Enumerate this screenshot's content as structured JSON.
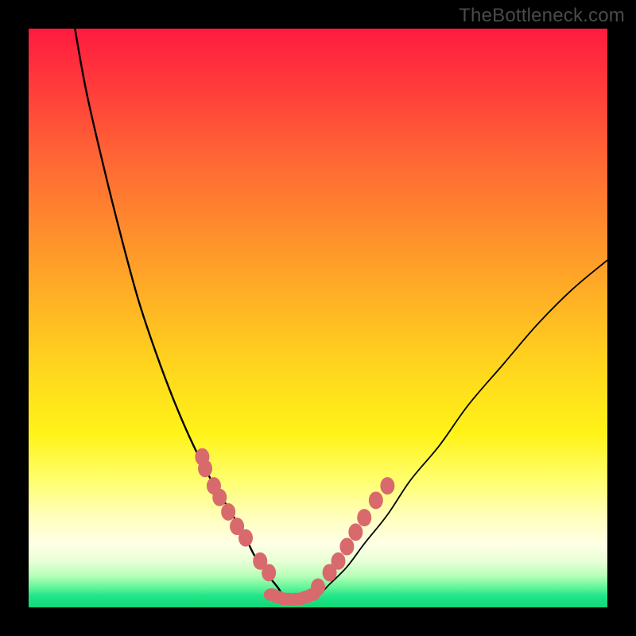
{
  "watermark": "TheBottleneck.com",
  "chart_data": {
    "type": "line",
    "title": "",
    "xlabel": "",
    "ylabel": "",
    "xlim": [
      0,
      100
    ],
    "ylim": [
      0,
      100
    ],
    "grid": false,
    "series": [
      {
        "name": "left-curve",
        "x": [
          8,
          10,
          13,
          16,
          19,
          22,
          25,
          28,
          31,
          34,
          37,
          39,
          41,
          43,
          44,
          45
        ],
        "values": [
          100,
          89,
          76,
          64,
          53,
          44,
          36,
          29,
          23,
          18,
          13,
          9,
          6,
          3.5,
          2,
          1
        ]
      },
      {
        "name": "right-curve",
        "x": [
          48,
          50,
          52,
          55,
          58,
          62,
          66,
          71,
          76,
          82,
          88,
          94,
          100
        ],
        "values": [
          1,
          2,
          4,
          7,
          11,
          16,
          22,
          28,
          35,
          42,
          49,
          55,
          60
        ]
      },
      {
        "name": "left-dots",
        "x": [
          30,
          30.5,
          32,
          33,
          34.5,
          36,
          37.5,
          40,
          41.5
        ],
        "values": [
          26,
          24,
          21,
          19,
          16.5,
          14,
          12,
          8,
          6
        ]
      },
      {
        "name": "right-dots",
        "x": [
          50,
          52,
          53.5,
          55,
          56.5,
          58,
          60,
          62
        ],
        "values": [
          3.5,
          6,
          8,
          10.5,
          13,
          15.5,
          18.5,
          21
        ]
      },
      {
        "name": "bottom-band",
        "x": [
          42,
          43,
          44,
          45,
          46,
          47,
          48,
          49
        ],
        "values": [
          2.2,
          1.8,
          1.5,
          1.4,
          1.4,
          1.5,
          1.8,
          2.2
        ]
      }
    ],
    "colors": {
      "curve": "#000000",
      "dots": "#d86a6d"
    }
  }
}
